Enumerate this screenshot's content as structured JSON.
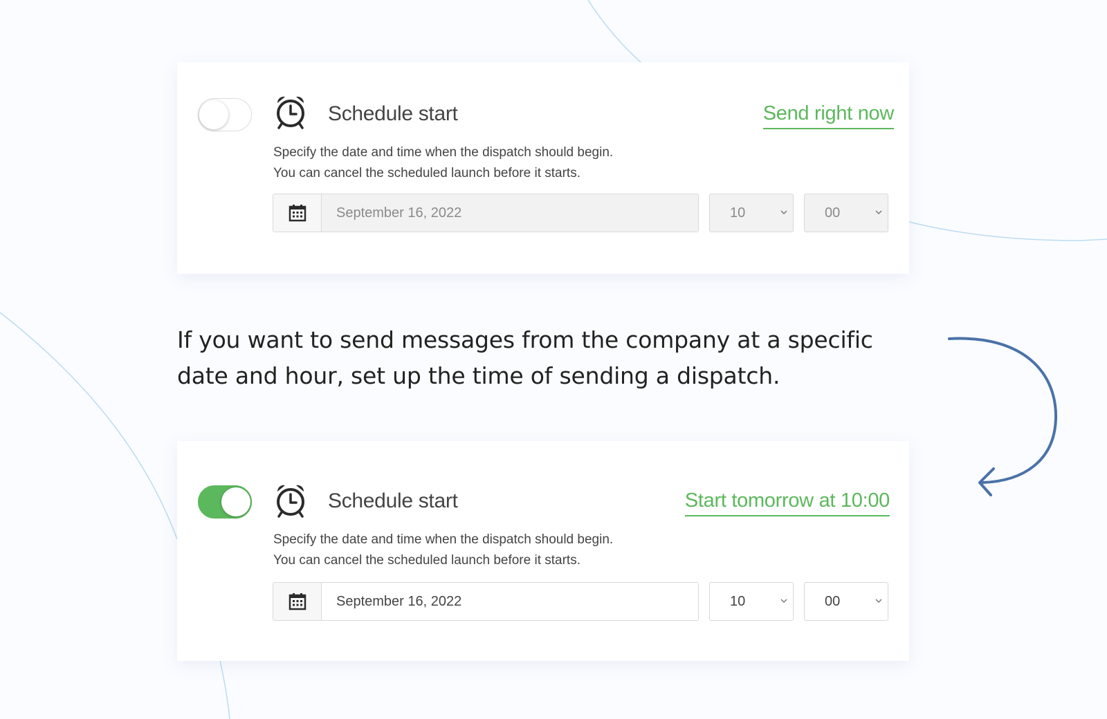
{
  "colors": {
    "accent_green": "#5cb85c",
    "arrow_blue": "#4a72a8",
    "decor_line": "#bcdcf0"
  },
  "top_card": {
    "toggle_on": false,
    "icon": "alarm-clock-icon",
    "title": "Schedule start",
    "action_label": "Send right now",
    "description_line1": "Specify the date and time when the dispatch should begin.",
    "description_line2": "You can cancel the scheduled launch before it starts.",
    "calendar_icon": "calendar-icon",
    "date_value": "September 16, 2022",
    "hour_value": "10",
    "minute_value": "00",
    "inputs_disabled": true
  },
  "caption": "If you want to send messages from the company at a specific date and hour, set up the time of sending a dispatch.",
  "bottom_card": {
    "toggle_on": true,
    "icon": "alarm-clock-icon",
    "title": "Schedule start",
    "action_label": "Start tomorrow at 10:00",
    "description_line1": "Specify the date and time when the dispatch should begin.",
    "description_line2": "You can cancel the scheduled launch before it starts.",
    "calendar_icon": "calendar-icon",
    "date_value": "September 16, 2022",
    "hour_value": "10",
    "minute_value": "00",
    "inputs_disabled": false
  }
}
